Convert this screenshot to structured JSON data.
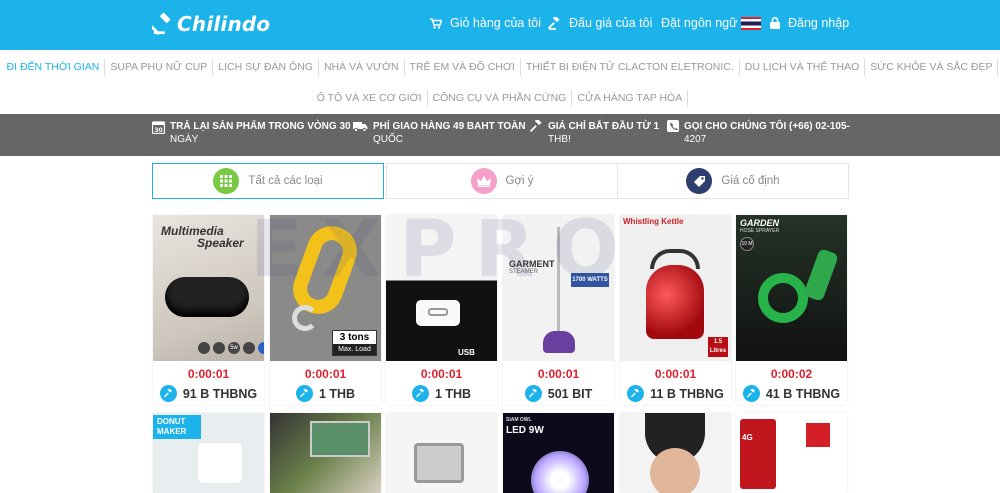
{
  "header": {
    "logo_text": "Chilindo",
    "cart": "Giỏ hàng của tôi",
    "auctions": "Đấu giá của tôi",
    "language": "Đặt ngôn ngữ",
    "login": "Đăng nhập"
  },
  "categories_row1": [
    "Đi đến thời gian",
    "Supa Phụ nữ Cup",
    "Lịch sự Đàn ông",
    "Nhà và vườn",
    "Trẻ em và đồ chơi",
    "Thiết bị điện tử Clacton Eletronic.",
    "Du lịch và thể thao",
    "Sức khỏe và sắc đẹp"
  ],
  "categories_row2": [
    "Ô tô và xe cơ giới",
    "Công cụ và Phần cứng",
    "Cửa hàng tạp hóa"
  ],
  "infobar": {
    "return_line1": "Trả lại sản phẩm trong vòng 30",
    "return_line2": "ngày",
    "shipping_line1": "Phí giao hàng 49 Baht toàn",
    "shipping_line2": "quốc",
    "price_line1": "Giá chỉ bắt đầu từ 1",
    "price_line2": "THB!",
    "call_line1": "Gọi cho chúng tôi (+66) 02-105-",
    "call_line2": "4207",
    "return_icon_text": "30"
  },
  "tabs": {
    "all": "Tất cả các loại",
    "suggest": "Gợi ý",
    "fixed": "Giá cố định"
  },
  "products": [
    {
      "timer": "0:00:01",
      "price": "91 B THBNG",
      "img_text1": "Multimedia",
      "img_text2": "Speaker",
      "icon_labels": [
        "5w"
      ]
    },
    {
      "timer": "0:00:01",
      "price": "1 THB",
      "img_text1": "3 tons",
      "img_text2": "Max. Load"
    },
    {
      "timer": "0:00:01",
      "price": "1 THB",
      "img_text1": "USB",
      "img_text2": ""
    },
    {
      "timer": "0:00:01",
      "price": "501 BIT",
      "img_text1": "GARMENT",
      "img_text2": "STEAMER",
      "img_text3": "1700 WATTS"
    },
    {
      "timer": "0:00:01",
      "price": "11 B THBNG",
      "img_text1": "Whistling Kettle",
      "img_text2": "1.5 Litres"
    },
    {
      "timer": "0:00:02",
      "price": "41 B THBNG",
      "img_text1": "GARDEN",
      "img_text2": "HOSE SPRAYER",
      "img_text3": "10 M"
    }
  ],
  "products_row2": [
    {
      "img_text": "DONUT MAKER"
    },
    {
      "img_text": ""
    },
    {
      "img_text": ""
    },
    {
      "img_text": "SIAM OWL",
      "img_text2": "LED 9W"
    },
    {
      "img_text": ""
    },
    {
      "img_text": "4G"
    }
  ],
  "watermark": "EXPRO",
  "colors": {
    "brand": "#1cb3ea",
    "timer": "#e0202c",
    "infobar": "#666666"
  }
}
